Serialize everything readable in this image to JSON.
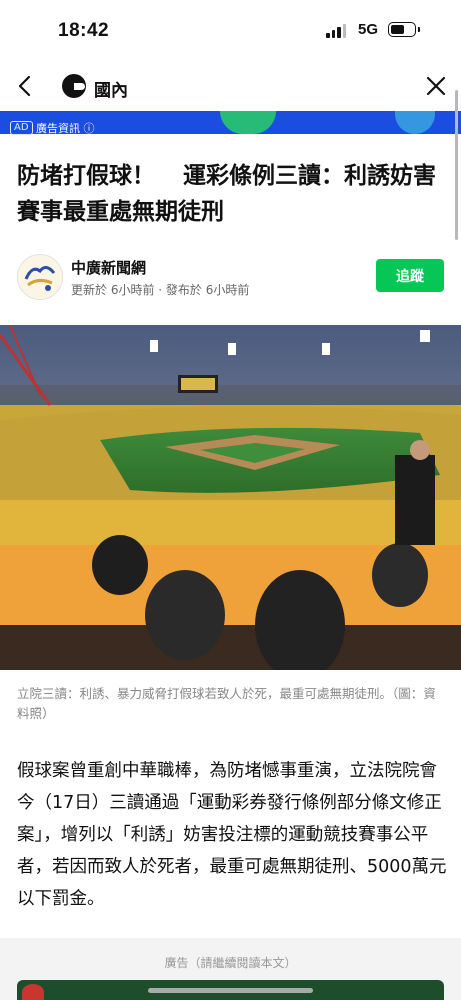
{
  "status_bar": {
    "time": "18:42",
    "network": "5G"
  },
  "header": {
    "channel": "國內"
  },
  "ad_banner": {
    "tag": "AD",
    "label": "廣告資訊 ⓘ"
  },
  "article": {
    "title_part1": "防堵打假球！",
    "title_part2": "運彩條例三讀：利誘妨害賽事最重處無期徒刑",
    "publisher": "中廣新聞網",
    "updated": "更新於 6小時前",
    "published": "發布於 6小時前",
    "follow_label": "追蹤",
    "image_caption": "立院三讀：利誘、暴力威脅打假球若致人於死，最重可處無期徒刑。（圖：資料照）",
    "body": "假球案曾重創中華職棒，為防堵憾事重演，立法院院會今（17日）三讀通過「運動彩券發行條例部分條文修正案」，增列以「利誘」妨害投注標的運動競技賽事公平者，若因而致人於死者，最重可處無期徒刑、5000萬元以下罰金。"
  },
  "ad_section": {
    "label": "廣告（請繼續閱讀本文）"
  },
  "colors": {
    "accent_green": "#06c755",
    "ad_blue": "#1b4ee0"
  }
}
